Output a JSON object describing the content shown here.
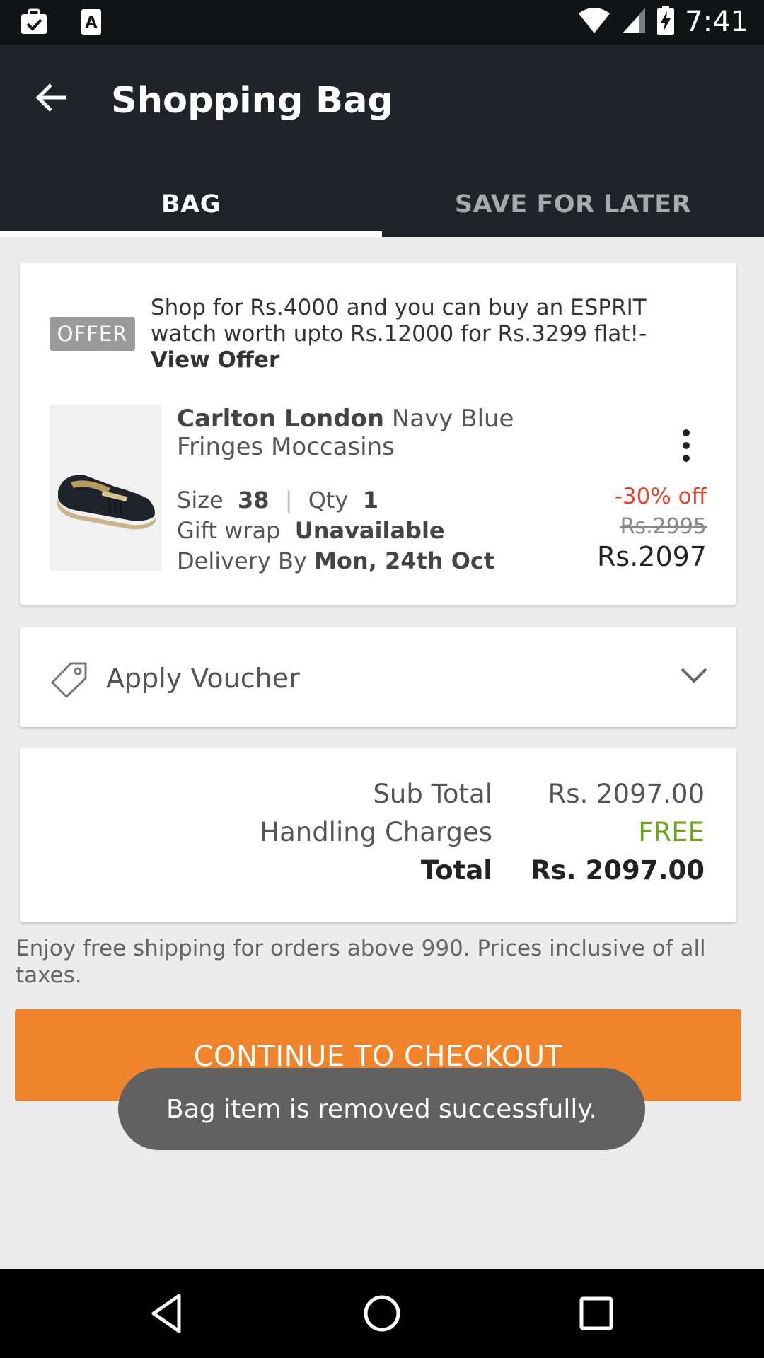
{
  "status_bar": {
    "time": "7:41",
    "left_icons": [
      "briefcase-check-icon",
      "font-a-icon"
    ],
    "right_icons": [
      "wifi-icon",
      "signal-icon",
      "battery-charging-icon"
    ]
  },
  "app_bar": {
    "title": "Shopping Bag",
    "back_icon": "arrow-back-icon"
  },
  "tabs": [
    {
      "label": "BAG",
      "active": true
    },
    {
      "label": "SAVE FOR LATER",
      "active": false
    }
  ],
  "offer": {
    "badge": "OFFER",
    "text": "Shop for Rs.4000 and you can buy an ESPRIT watch worth upto Rs.12000 for Rs.3299 flat!-",
    "link": "View Offer"
  },
  "product": {
    "brand": "Carlton London",
    "name": "Navy Blue Fringes Moccasins",
    "size_label": "Size",
    "size_value": "38",
    "qty_label": "Qty",
    "qty_value": "1",
    "gift_wrap_label": "Gift wrap",
    "gift_wrap_value": "Unavailable",
    "delivery_label": "Delivery By",
    "delivery_value": "Mon, 24th Oct",
    "discount": "-30% off",
    "mrp": "Rs.2995",
    "price": "Rs.2097"
  },
  "voucher": {
    "label": "Apply Voucher"
  },
  "totals": {
    "sub_total_label": "Sub Total",
    "sub_total_value": "Rs. 2097.00",
    "handling_label": "Handling Charges",
    "handling_value": "FREE",
    "total_label": "Total",
    "total_value": "Rs. 2097.00"
  },
  "footnote": "Enjoy free shipping for orders above 990. Prices inclusive of all taxes.",
  "checkout_label": "CONTINUE TO CHECKOUT",
  "toast": "Bag item is removed successfully.",
  "colors": {
    "app_bar": "#202428",
    "checkout": "#f1832a",
    "discount": "#e0452e",
    "free": "#6aa21e"
  }
}
